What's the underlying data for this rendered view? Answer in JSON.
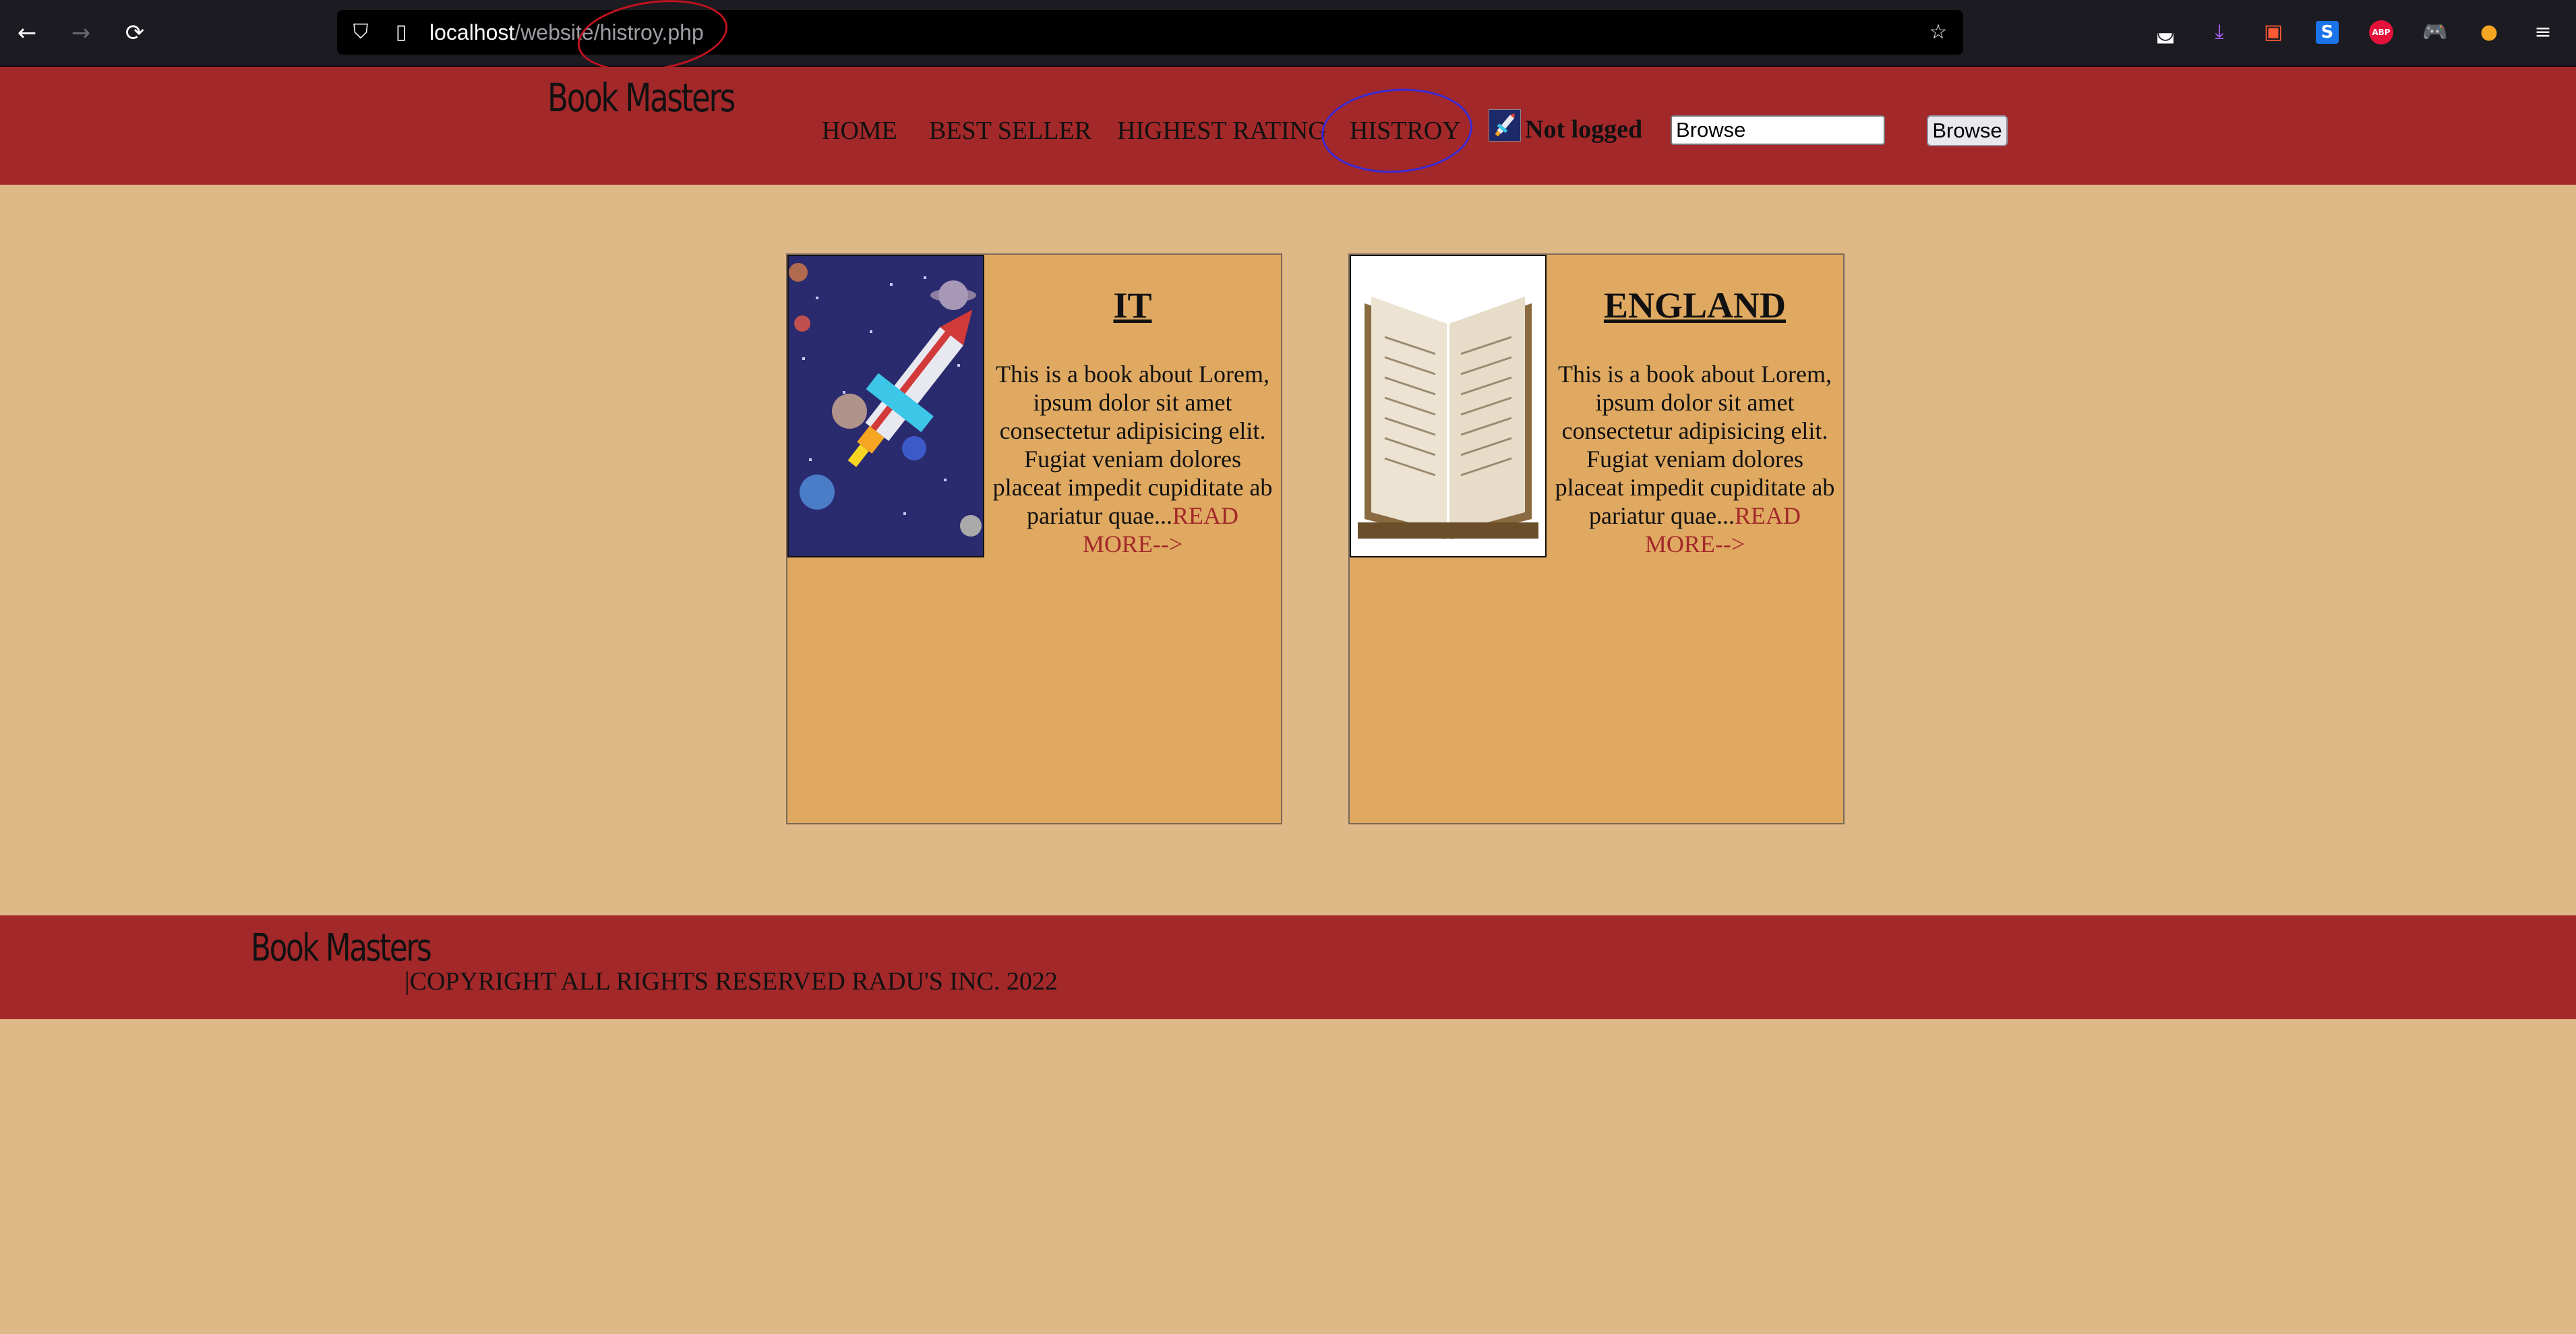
{
  "browser": {
    "url_host": "localhost",
    "url_path": "/website/histroy.php"
  },
  "header": {
    "logo": "Book Masters",
    "nav": [
      "HOME",
      "BEST SELLER",
      "HIGHEST RATING",
      "HISTROY"
    ],
    "user_status": "Not logged",
    "search_value": "Browse",
    "search_button": "Browse"
  },
  "books": [
    {
      "title": "IT",
      "description": "This is a book about Lorem, ipsum dolor sit amet consectetur adipisicing elit. Fugiat veniam dolores placeat impedit cupiditate ab pariatur quae...",
      "read_more": "READ MORE-->"
    },
    {
      "title": "ENGLAND",
      "description": "This is a book about Lorem, ipsum dolor sit amet consectetur adipisicing elit. Fugiat veniam dolores placeat impedit cupiditate ab pariatur quae...",
      "read_more": "READ MORE-->"
    }
  ],
  "footer": {
    "logo": "Book Masters",
    "copyright": "|COPYRIGHT ALL RIGHTS RESERVED RADU'S INC. 2022"
  },
  "colors": {
    "page_bg": "#deb887",
    "header_bg": "#a3282a",
    "card_bg": "#e0a961",
    "link": "#a3282a"
  },
  "icons": [
    "back-arrow-icon",
    "forward-arrow-icon",
    "reload-icon",
    "shield-icon",
    "page-icon",
    "star-icon",
    "pocket-icon",
    "download-icon",
    "screenshot-icon",
    "extension-s-icon",
    "adblock-icon",
    "extension-gamepad-icon",
    "extension-drop-icon",
    "menu-icon"
  ]
}
